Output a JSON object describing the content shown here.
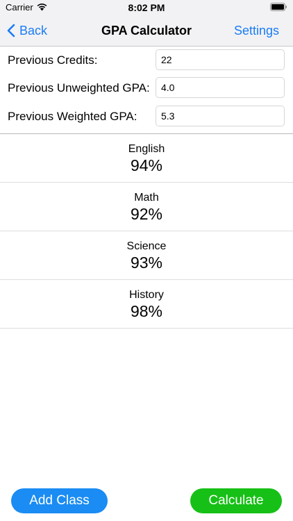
{
  "status_bar": {
    "carrier": "Carrier",
    "time": "8:02 PM",
    "wifi_icon": "wifi-icon",
    "battery_icon": "battery-icon"
  },
  "nav": {
    "back_label": "Back",
    "title": "GPA Calculator",
    "settings_label": "Settings",
    "accent_color": "#1a7cf5"
  },
  "form": {
    "previous_credits": {
      "label": "Previous Credits:",
      "value": "22"
    },
    "previous_unweighted_gpa": {
      "label": "Previous Unweighted GPA:",
      "value": "4.0"
    },
    "previous_weighted_gpa": {
      "label": "Previous Weighted GPA:",
      "value": "5.3"
    }
  },
  "classes": [
    {
      "name": "English",
      "grade": "94%"
    },
    {
      "name": "Math",
      "grade": "92%"
    },
    {
      "name": "Science",
      "grade": "93%"
    },
    {
      "name": "History",
      "grade": "98%"
    }
  ],
  "buttons": {
    "add_class": "Add Class",
    "calculate": "Calculate",
    "add_class_color": "#1a8cf3",
    "calculate_color": "#16c016"
  }
}
